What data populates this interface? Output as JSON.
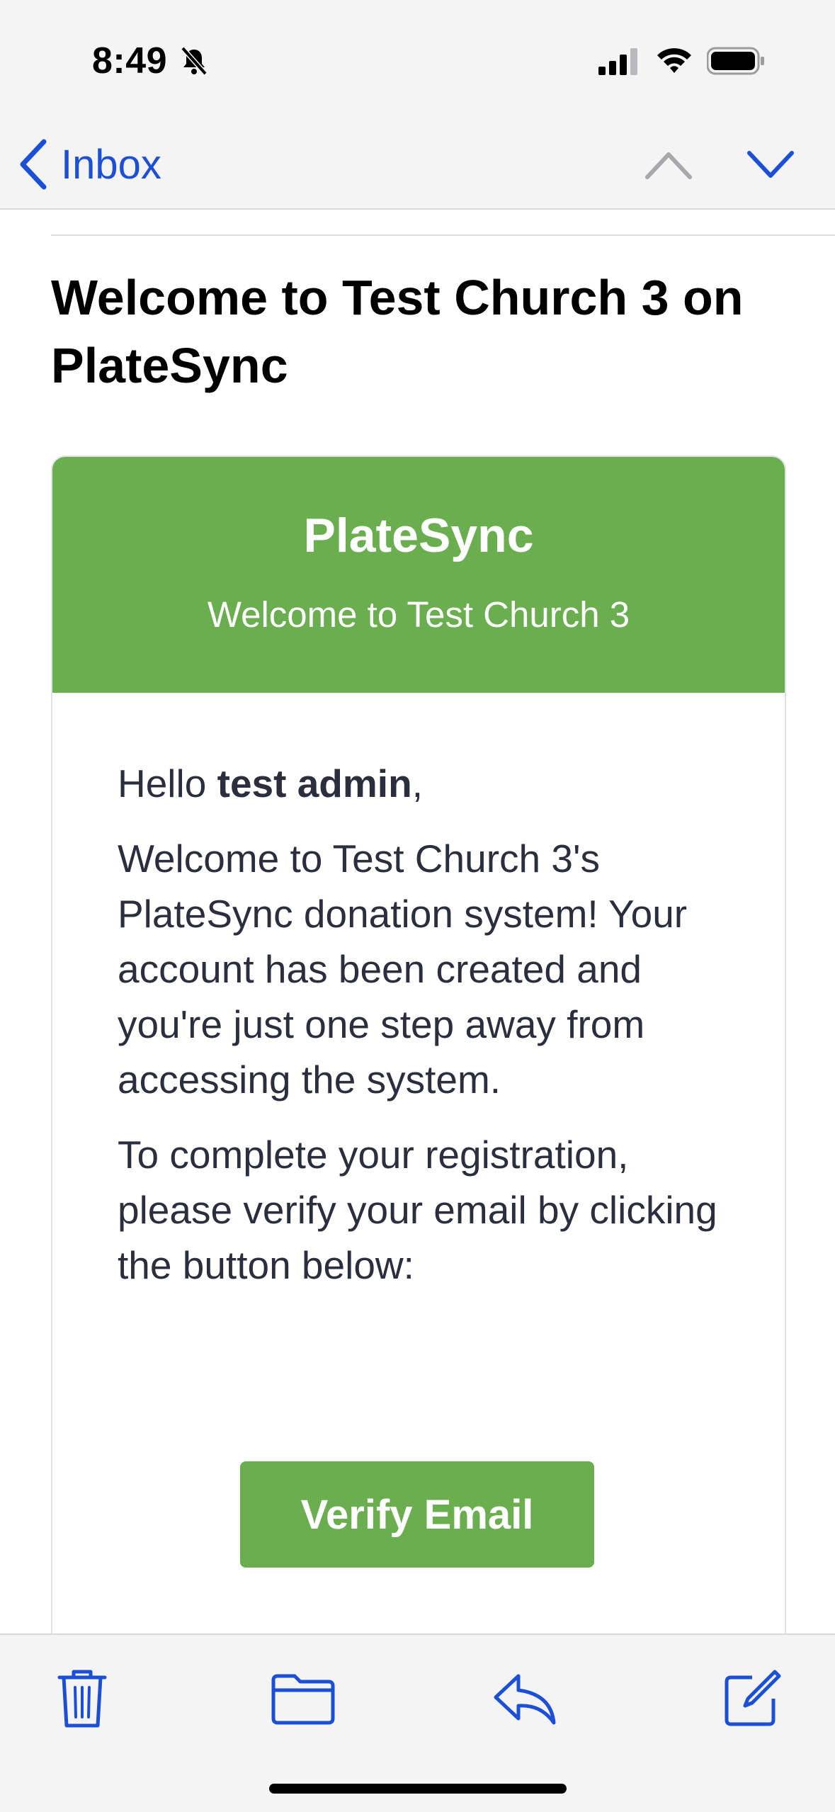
{
  "status_bar": {
    "time": "8:49"
  },
  "nav": {
    "back_label": "Inbox"
  },
  "email": {
    "subject": "Welcome to Test Church 3 on PlateSync",
    "header": {
      "brand": "PlateSync",
      "subtitle": "Welcome to Test Church 3"
    },
    "greeting_prefix": "Hello ",
    "greeting_name": "test admin",
    "greeting_suffix": ",",
    "paragraph_1": "Welcome to Test Church 3's PlateSync donation system! Your account has been created and you're just one step away from accessing the system.",
    "paragraph_2": "To complete your registration, please verify your email by clicking the button below:",
    "verify_button_label": "Verify Email"
  },
  "colors": {
    "accent_blue": "#1a4fd6",
    "brand_green": "#6aae4f",
    "body_text": "#2b2f3d"
  },
  "toolbar": {
    "icons": [
      "trash-icon",
      "folder-icon",
      "reply-icon",
      "compose-icon"
    ]
  }
}
